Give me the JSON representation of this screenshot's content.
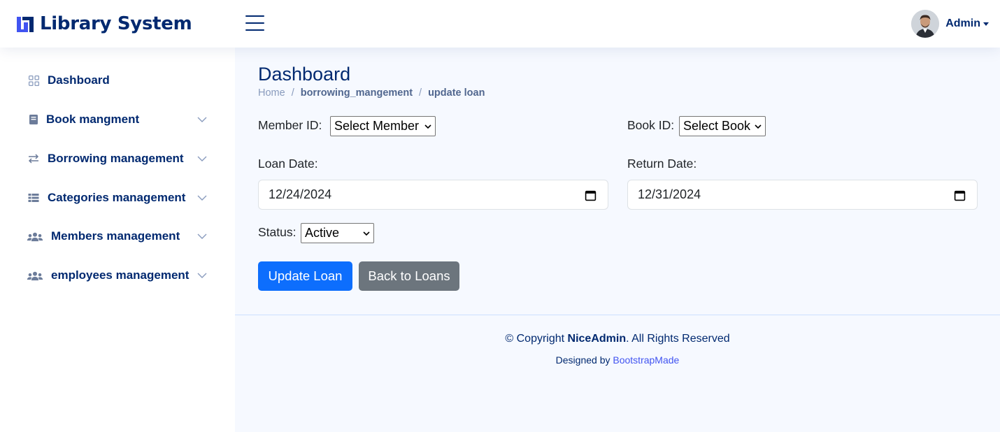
{
  "header": {
    "logo_text": "Library System",
    "user_name": "Admin"
  },
  "sidebar": {
    "items": [
      {
        "label": "Dashboard",
        "icon": "grid-icon",
        "expandable": false
      },
      {
        "label": "Book mangment",
        "icon": "book-icon",
        "expandable": true
      },
      {
        "label": "Borrowing management",
        "icon": "arrows-exchange-icon",
        "expandable": true
      },
      {
        "label": "Categories management",
        "icon": "list-icon",
        "expandable": true
      },
      {
        "label": "Members management",
        "icon": "people-icon",
        "expandable": true
      },
      {
        "label": "employees management",
        "icon": "people-icon",
        "expandable": true
      }
    ]
  },
  "main": {
    "page_title": "Dashboard",
    "breadcrumb": {
      "home": "Home",
      "separator": "/",
      "items": [
        "borrowing_mangement",
        "update loan"
      ]
    },
    "form": {
      "member_label": "Member ID:",
      "member_select": "Select Member",
      "book_label": "Book ID:",
      "book_select": "Select Book",
      "loan_date_label": "Loan Date:",
      "loan_date_value": "12/24/2024",
      "return_date_label": "Return Date:",
      "return_date_value": "12/31/2024",
      "status_label": "Status:",
      "status_value": "Active",
      "update_button": "Update Loan",
      "back_button": "Back to Loans"
    },
    "footer": {
      "copyright_prefix": "© Copyright ",
      "copyright_brand": "NiceAdmin",
      "copyright_suffix": ". All Rights Reserved",
      "designed_by": "Designed by ",
      "designer_link": "BootstrapMade"
    }
  },
  "colors": {
    "brand": "#012970",
    "primary": "#0d6efd",
    "secondary": "#6c757d",
    "background": "#f6f9ff",
    "link": "#4154f1"
  }
}
